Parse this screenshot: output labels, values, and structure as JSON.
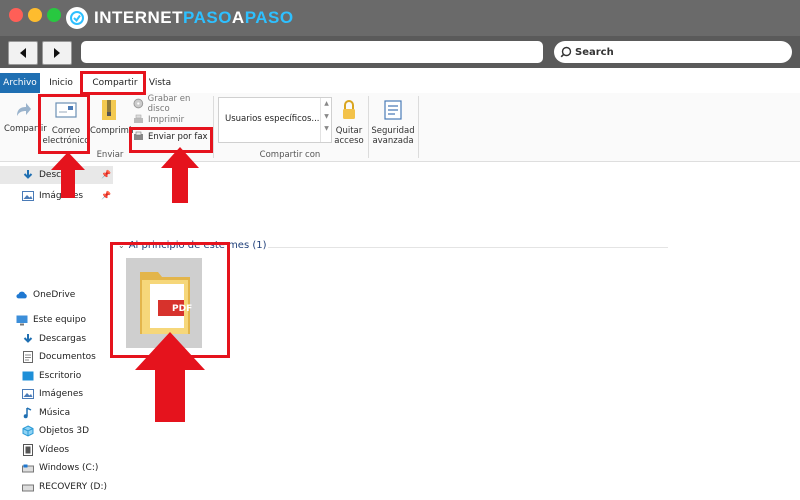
{
  "brand": {
    "part1": "INTERNET",
    "part2": "PASO",
    "a": "A",
    "part3": "PASO"
  },
  "search": {
    "label": "Search"
  },
  "tabs": [
    {
      "label": "Archivo"
    },
    {
      "label": "Inicio"
    },
    {
      "label": "Compartir"
    },
    {
      "label": "Vista"
    }
  ],
  "ribbon": {
    "compartir": "Compartir",
    "correo_line1": "Correo",
    "correo_line2": "electrónico",
    "comprimir": "Comprimir",
    "grabar": "Grabar en disco",
    "imprimir": "Imprimir",
    "fax": "Enviar por fax",
    "group_enviar": "Enviar",
    "usuarios": "Usuarios específicos...",
    "quitar_line1": "Quitar",
    "quitar_line2": "acceso",
    "group_compartir_con": "Compartir con",
    "seguridad_line1": "Seguridad",
    "seguridad_line2": "avanzada"
  },
  "nav": {
    "quick": [
      {
        "label": "Desca"
      },
      {
        "label": "Imágenes"
      }
    ],
    "onedrive": "OneDrive",
    "este_equipo": "Este equipo",
    "items": [
      {
        "label": "Descargas"
      },
      {
        "label": "Documentos"
      },
      {
        "label": "Escritorio"
      },
      {
        "label": "Imágenes"
      },
      {
        "label": "Música"
      },
      {
        "label": "Objetos 3D"
      },
      {
        "label": "Vídeos"
      },
      {
        "label": "Windows (C:)"
      },
      {
        "label": "RECOVERY (D:)"
      }
    ]
  },
  "content": {
    "group_header": "Al principio de este mes (1)"
  },
  "file": {
    "badge": "PDF"
  },
  "colors": {
    "highlight_red": "#e5131d",
    "archivo_blue": "#1f6fb2",
    "brand_accent": "#2ec0ff"
  }
}
